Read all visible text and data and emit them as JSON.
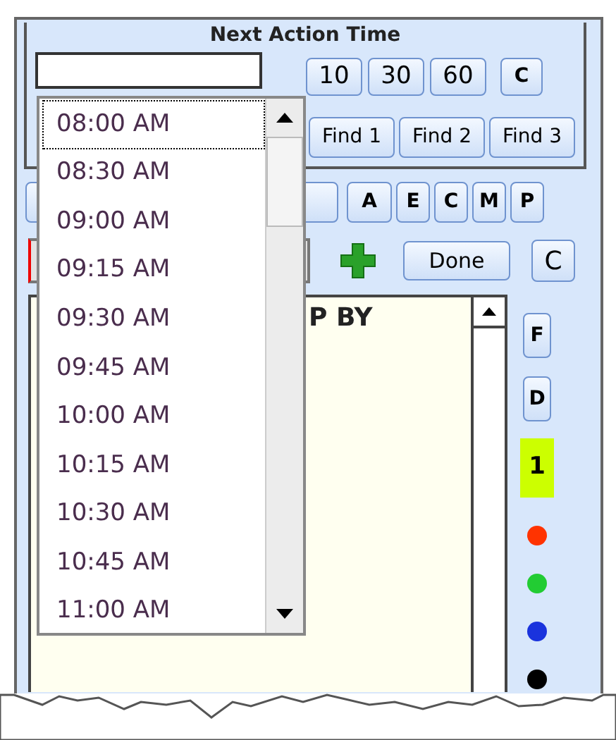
{
  "next_action": {
    "title": "Next Action Time",
    "quick_buttons": [
      "10",
      "30",
      "60",
      "C"
    ],
    "find_buttons": [
      "Find 1",
      "Find 2",
      "Find 3"
    ]
  },
  "filter_buttons": [
    "A",
    "E",
    "C",
    "M",
    "P"
  ],
  "action_bar": {
    "done": "Done",
    "clear": "C"
  },
  "list": {
    "header": "P BY"
  },
  "side": {
    "buttons": [
      "F",
      "D"
    ],
    "badge": "1",
    "dots": [
      {
        "color": "#ff3300"
      },
      {
        "color": "#22cc33"
      },
      {
        "color": "#1a33dd"
      },
      {
        "color": "#000000"
      }
    ]
  },
  "dropdown": {
    "items": [
      {
        "label": "08:00 AM",
        "selected": true
      },
      {
        "label": "08:30 AM",
        "selected": false
      },
      {
        "label": "09:00 AM",
        "selected": false
      },
      {
        "label": "09:15 AM",
        "selected": false
      },
      {
        "label": "09:30 AM",
        "selected": false
      },
      {
        "label": "09:45 AM",
        "selected": false
      },
      {
        "label": "10:00 AM",
        "selected": false
      },
      {
        "label": "10:15 AM",
        "selected": false
      },
      {
        "label": "10:30 AM",
        "selected": false
      },
      {
        "label": "10:45 AM",
        "selected": false
      },
      {
        "label": "11:00 AM",
        "selected": false
      }
    ]
  }
}
